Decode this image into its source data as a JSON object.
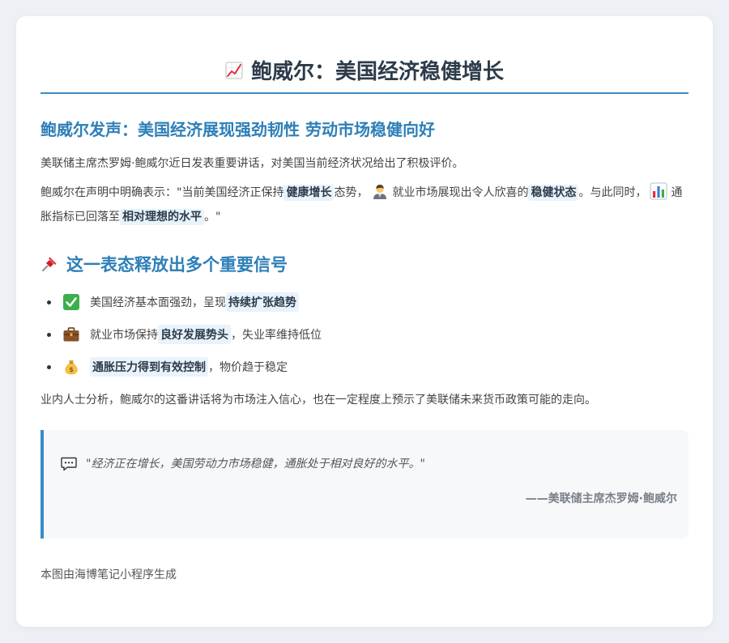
{
  "title": {
    "text": "鲍威尔：美国经济稳健增长",
    "icon": "chart-increasing-icon"
  },
  "subtitle": "鲍威尔发声：美国经济展现强劲韧性 劳动市场稳健向好",
  "intro": "美联储主席杰罗姆·鲍威尔近日发表重要讲话，对美国当前经济状况给出了积极评价。",
  "statement": {
    "part1": "鲍威尔在声明中明确表示：\"当前美国经济正保持",
    "hl1": "健康增长",
    "part2": "态势，",
    "icon1": "office-worker-icon",
    "part3": "就业市场展现出令人欣喜的",
    "hl2": "稳健状态",
    "part4": "。与此同时，",
    "icon2": "bar-chart-icon",
    "part5": "通胀指标已回落至",
    "hl3": "相对理想的水平",
    "part6": "。\""
  },
  "section": {
    "title": "这一表态释放出多个重要信号",
    "icon": "pushpin-icon"
  },
  "signals": [
    {
      "icon": "check-mark-icon",
      "before": "美国经济基本面强劲，呈现",
      "highlight": "持续扩张趋势",
      "after": ""
    },
    {
      "icon": "briefcase-icon",
      "before": "就业市场保持",
      "highlight": "良好发展势头",
      "after": "，失业率维持低位"
    },
    {
      "icon": "money-bag-icon",
      "before": "",
      "highlight": "通胀压力得到有效控制",
      "after": "，物价趋于稳定"
    }
  ],
  "analysis": "业内人士分析，鲍威尔的这番讲话将为市场注入信心，也在一定程度上预示了美联储未来货币政策可能的走向。",
  "quote": {
    "icon": "speech-bubble-icon",
    "text": "\"经济正在增长，美国劳动力市场稳健，通胀处于相对良好的水平。\"",
    "author": "——美联储主席杰罗姆·鲍威尔"
  },
  "footer": "本图由海博笔记小程序生成",
  "colors": {
    "accent": "#3a8cc5",
    "heading": "#2d7fb8",
    "highlight_bg": "#e8f3fb"
  }
}
